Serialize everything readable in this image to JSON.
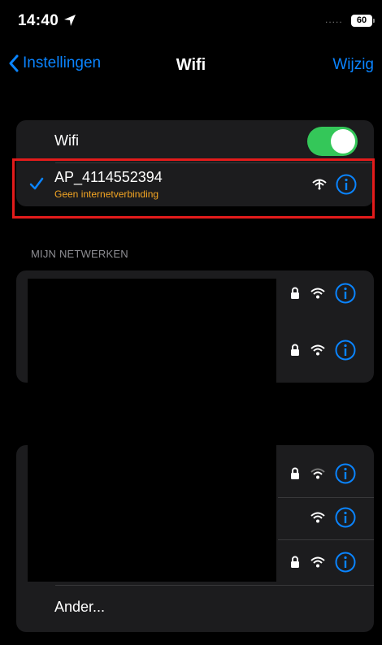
{
  "status_bar": {
    "time": "14:40",
    "battery": "60",
    "signal_dots": "....."
  },
  "nav": {
    "back_label": "Instellingen",
    "title": "Wifi",
    "edit_label": "Wijzig"
  },
  "wifi_toggle": {
    "label": "Wifi",
    "on": true
  },
  "connected_network": {
    "name": "AP_4114552394",
    "status": "Geen internetverbinding",
    "status_color": "#f5a623"
  },
  "my_networks": {
    "header": "MIJN NETWERKEN"
  },
  "other": {
    "label": "Ander..."
  },
  "colors": {
    "accent": "#0a84ff",
    "toggle_on": "#34c759",
    "highlight": "#e31b1b"
  }
}
